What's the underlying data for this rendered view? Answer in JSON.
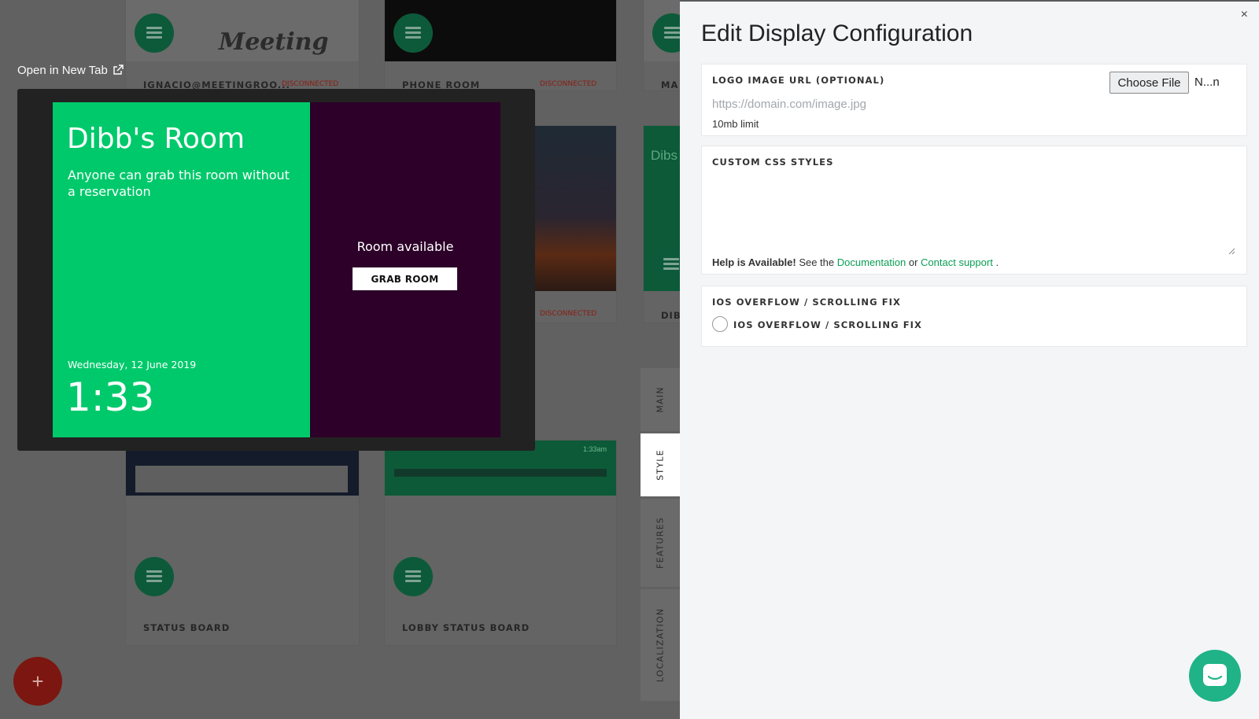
{
  "background": {
    "open_in_new_tab": "Open in New Tab",
    "cards": [
      {
        "name": "IGNACIO@MEETINGROO...",
        "status": "DISCONNECTED"
      },
      {
        "name": "PHONE ROOM",
        "status": "DISCONNECTED"
      },
      {
        "name": "MA",
        "status": ""
      },
      {
        "name": "",
        "status": "DISCONNECTED"
      },
      {
        "name": "DIB",
        "status": ""
      },
      {
        "name": "STATUS BOARD",
        "status": ""
      },
      {
        "name": "LOBBY STATUS BOARD",
        "status": ""
      }
    ],
    "thumb_text": {
      "meeting_logo": "Meeting",
      "lobby_time": "1:33am",
      "dibs_partial": "Dibs"
    }
  },
  "preview": {
    "room_name": "Dibb's Room",
    "subtitle": "Anyone can grab this room without a reservation",
    "date": "Wednesday, 12 June 2019",
    "time": "1:33",
    "availability": "Room available",
    "grab_button": "GRAB ROOM",
    "colors": {
      "available": "#00c96b",
      "side": "#2c0028"
    }
  },
  "tabs": [
    {
      "label": "MAIN",
      "active": false
    },
    {
      "label": "STYLE",
      "active": true
    },
    {
      "label": "FEATURES",
      "active": false
    },
    {
      "label": "LOCALIZATION",
      "active": false
    }
  ],
  "panel": {
    "close": "×",
    "title": "Edit Display Configuration",
    "logo": {
      "label": "LOGO IMAGE URL (OPTIONAL)",
      "placeholder": "https://domain.com/image.jpg",
      "limit": "10mb limit",
      "choose_file": "Choose File",
      "file_name": "N...n"
    },
    "css": {
      "label": "CUSTOM CSS STYLES",
      "help_bold": "Help is Available!",
      "help_text": "See the",
      "doc_link": "Documentation",
      "or": "or",
      "support_link": "Contact support",
      "period": "."
    },
    "ios": {
      "label": "IOS OVERFLOW / SCROLLING FIX",
      "option": "IOS OVERFLOW / SCROLLING FIX"
    }
  },
  "fab": {
    "add": "+"
  },
  "colors": {
    "accent": "#0a9e55",
    "chat": "#1fb387",
    "add_fab": "#7b1710"
  }
}
